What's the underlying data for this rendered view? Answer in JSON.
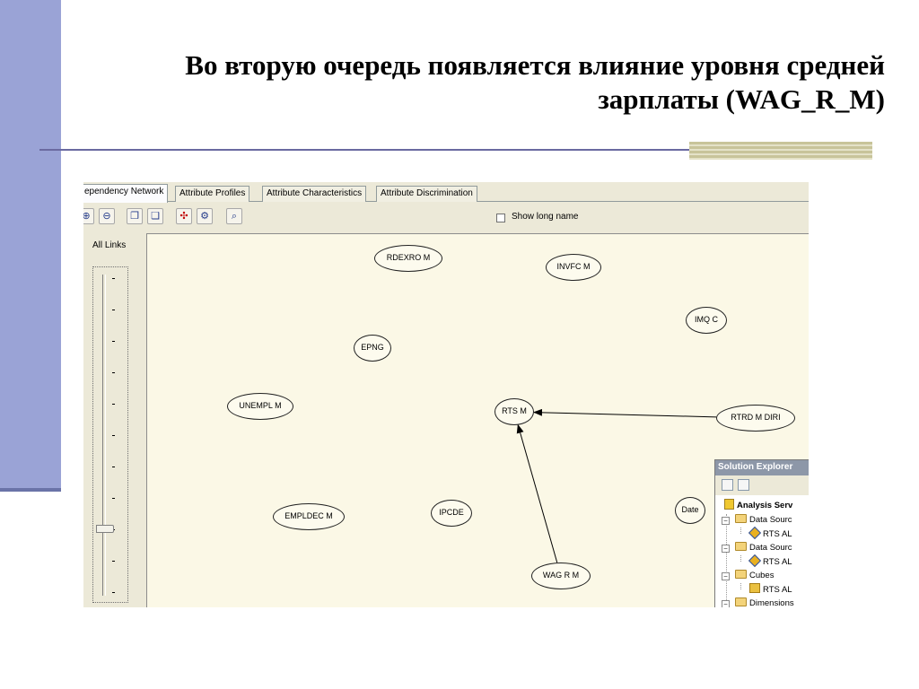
{
  "slide": {
    "title_line1": "Во вторую очередь появляется влияние уровня средней",
    "title_line2": "зарплаты (WAG_R_M)"
  },
  "tabs": [
    {
      "label": "ependency Network",
      "active": true
    },
    {
      "label": "Attribute Profiles",
      "active": false
    },
    {
      "label": "Attribute Characteristics",
      "active": false
    },
    {
      "label": "Attribute Discrimination",
      "active": false
    }
  ],
  "toolbar": {
    "show_long_name_label": "Show long name",
    "show_long_name_checked": false
  },
  "slider": {
    "label": "All Links",
    "tick_label": "-",
    "tick_count": 11
  },
  "network": {
    "nodes": [
      {
        "id": "rdexro",
        "label": "RDEXRO M"
      },
      {
        "id": "invfc",
        "label": "INVFC M"
      },
      {
        "id": "imqc",
        "label": "IMQ C"
      },
      {
        "id": "epng",
        "label": "EPNG"
      },
      {
        "id": "unempl",
        "label": "UNEMPL M"
      },
      {
        "id": "rts",
        "label": "RTS M"
      },
      {
        "id": "rtrd",
        "label": "RTRD M DIRI"
      },
      {
        "id": "empldec",
        "label": "EMPLDEC M"
      },
      {
        "id": "ipcde",
        "label": "IPCDE"
      },
      {
        "id": "date",
        "label": "Date"
      },
      {
        "id": "wag",
        "label": "WAG R M"
      }
    ],
    "edges": [
      {
        "from": "rtrd",
        "to": "rts"
      },
      {
        "from": "wag",
        "to": "rts"
      }
    ]
  },
  "solution_explorer": {
    "title": "Solution Explorer",
    "items": [
      {
        "label": "Analysis Serv"
      },
      {
        "label": "Data Sourc"
      },
      {
        "label": "RTS AL"
      },
      {
        "label": "Data Sourc"
      },
      {
        "label": "RTS AL"
      },
      {
        "label": "Cubes"
      },
      {
        "label": "RTS AL"
      },
      {
        "label": "Dimensions"
      }
    ]
  },
  "colors": {
    "left_bar": "#9aa3d6",
    "canvas_bg": "#fbf8e6",
    "window_bg": "#ece9d8"
  }
}
